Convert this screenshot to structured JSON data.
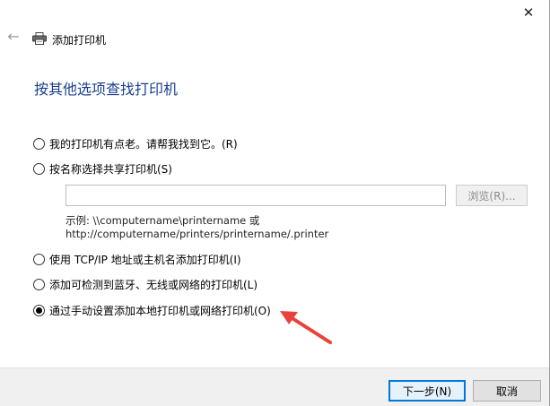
{
  "window": {
    "close_glyph": "✕"
  },
  "header": {
    "back_glyph": "←",
    "title": "添加打印机",
    "icon": "printer-icon"
  },
  "page": {
    "title": "按其他选项查找打印机"
  },
  "options": [
    {
      "label": "我的打印机有点老。请帮我找到它。(R)",
      "checked": false
    },
    {
      "label": "按名称选择共享打印机(S)",
      "checked": false
    },
    {
      "label": "使用 TCP/IP 地址或主机名添加打印机(I)",
      "checked": false
    },
    {
      "label": "添加可检测到蓝牙、无线或网络的打印机(L)",
      "checked": false
    },
    {
      "label": "通过手动设置添加本地打印机或网络打印机(O)",
      "checked": true
    }
  ],
  "share": {
    "input_value": "",
    "browse_label": "浏览(R)...",
    "example_line1": "示例: \\\\computername\\printername 或",
    "example_line2": "http://computername/printers/printername/.printer"
  },
  "footer": {
    "next_label": "下一步(N)",
    "cancel_label": "取消"
  },
  "colors": {
    "title": "#1a3e8c",
    "annotation_arrow": "#e8423a",
    "primary_border": "#0078d7"
  }
}
